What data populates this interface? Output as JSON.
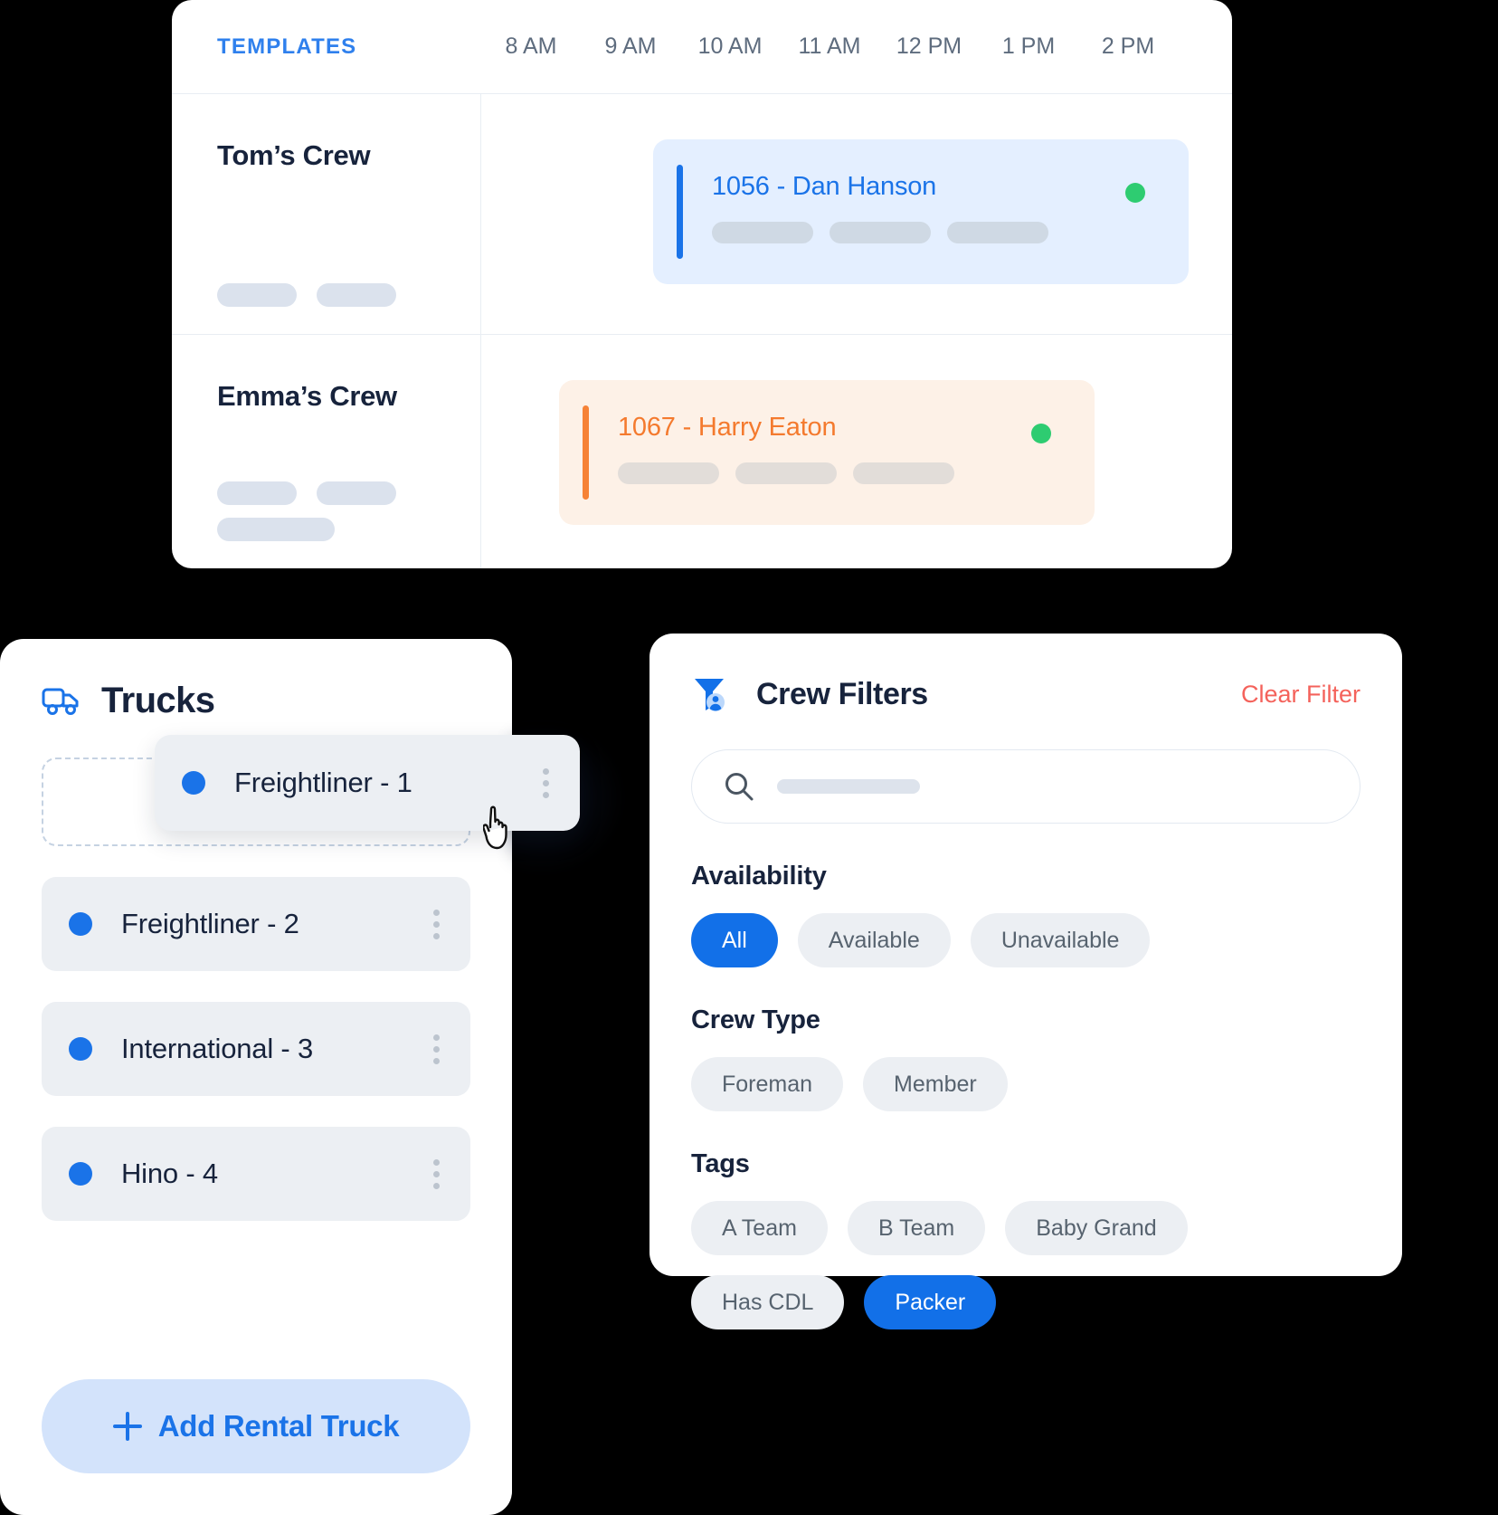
{
  "schedule": {
    "templates_label": "TEMPLATES",
    "time_columns": [
      "8 AM",
      "9 AM",
      "10 AM",
      "11 AM",
      "12 PM",
      "1 PM",
      "2 PM"
    ],
    "rows": [
      {
        "crew_name": "Tom’s Crew",
        "job": {
          "title": "1056 - Dan Hanson",
          "accent": "#1a73e8",
          "background": "#e4efff",
          "status_color": "#2ecc71"
        }
      },
      {
        "crew_name": "Emma’s Crew",
        "job": {
          "title": "1067 - Harry Eaton",
          "accent": "#f68236",
          "background": "#fdf1e7",
          "status_color": "#2ecc71"
        }
      }
    ]
  },
  "trucks": {
    "title": "Trucks",
    "icon": "truck-icon",
    "dragging_item": {
      "label": "Freightliner - 1",
      "dot_color": "#1a73e8"
    },
    "items": [
      {
        "label": "Freightliner - 2",
        "dot_color": "#1a73e8"
      },
      {
        "label": "International - 3",
        "dot_color": "#1a73e8"
      },
      {
        "label": "Hino - 4",
        "dot_color": "#1a73e8"
      }
    ],
    "add_rental_label": "Add Rental Truck",
    "add_rental_icon": "plus-icon",
    "accent": "#1a73e8"
  },
  "crew_filters": {
    "title": "Crew Filters",
    "icon": "filter-user-icon",
    "clear_label": "Clear Filter",
    "clear_color": "#f4625b",
    "search": {
      "icon": "search-icon",
      "value": "",
      "placeholder": ""
    },
    "groups": [
      {
        "title": "Availability",
        "options": [
          {
            "label": "All",
            "selected": true
          },
          {
            "label": "Available",
            "selected": false
          },
          {
            "label": "Unavailable",
            "selected": false
          }
        ]
      },
      {
        "title": "Crew Type",
        "options": [
          {
            "label": "Foreman",
            "selected": false
          },
          {
            "label": "Member",
            "selected": false
          }
        ]
      },
      {
        "title": "Tags",
        "options": [
          {
            "label": "A Team",
            "selected": false
          },
          {
            "label": "B Team",
            "selected": false
          },
          {
            "label": "Baby  Grand",
            "selected": false
          },
          {
            "label": "Has CDL",
            "selected": false
          },
          {
            "label": "Packer",
            "selected": true
          }
        ]
      }
    ],
    "accent": "#1270e8"
  }
}
